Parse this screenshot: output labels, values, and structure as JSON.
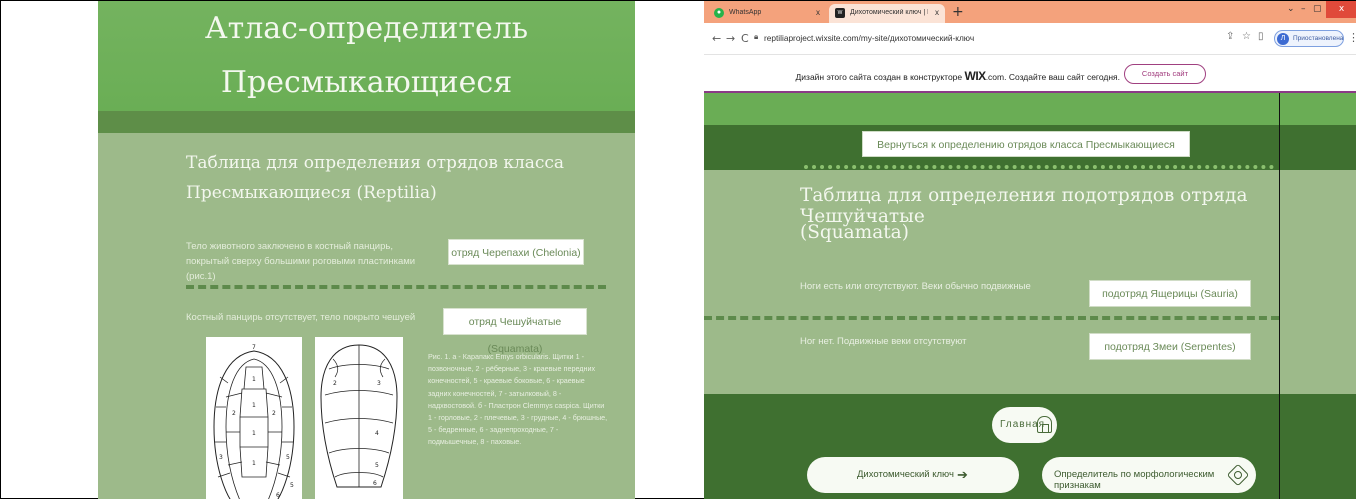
{
  "left": {
    "hero_title_line1": "Атлас-определитель",
    "hero_title_line2": "Пресмыкающиеся",
    "table_title_line1": "Таблица для определения отрядов класса",
    "table_title_line2": "Пресмыкающиеся (Reptilia)",
    "row1_text": "Тело животного заключено в костный панцирь, покрытый сверху большими роговыми пластинками (рис.1)",
    "row1_button": "отряд Черепахи (Chelonia)",
    "row2_text": "Костный панцирь отсутствует, тело покрыто чешуей",
    "row2_button": "отряд Чешуйчатые (Squamata)",
    "figure_caption": "Рис. 1. а - Карапакс Emys orbicularis. Щитки 1 - позвоночные, 2 - рёберные, 3 - краевые передних конечностей, 5 - краевые боковые, 6 - краевые задних конечностей, 7 - затылковый, 8 - надхвостовой. б - Пластрон Clemmys caspica. Щитки 1 - горловые, 2 - плечевые, 3 - грудные, 4 - брюшные, 5 - бедренные, 6 - заднепроходные, 7 - подмышечные, 8 - паховые."
  },
  "browser": {
    "tabs": [
      {
        "label": "WhatsApp",
        "icon": "whatsapp-icon",
        "close": "x"
      },
      {
        "label": "Дихотомический ключ | Пресм",
        "icon": "wix-icon",
        "close": "x"
      }
    ],
    "new_tab": "+",
    "url": "reptiliaproject.wixsite.com/my-site/дихотомический-ключ",
    "profile_initial": "Л",
    "profile_label": "Приостановлена",
    "window_controls": [
      "⌄",
      "–",
      "▢",
      "x"
    ]
  },
  "wix_banner": {
    "text_before": "Дизайн этого сайта создан в конструкторе",
    "brand": "WIX",
    "text_after": ".com. Создайте ваш сайт сегодня.",
    "button": "Создать сайт"
  },
  "right": {
    "back_button": "Вернуться к определению отрядов класса Пресмыкающиеся",
    "table_title_line1": "Таблица для определения подотрядов отряда Чешуйчатые",
    "table_title_line2": "(Squamata)",
    "row1_text": "Ноги есть или отсутствуют. Веки обычно подвижные",
    "row1_button": "подотряд Ящерицы (Sauria)",
    "row2_text": "Ног нет. Подвижные веки отсутствуют",
    "row2_button": "подотряд Змеи (Serpentes)",
    "home_button": "Главная",
    "nav_button1": "Дихотомический ключ",
    "nav_button2": "Определитель по морфологическим признакам"
  }
}
